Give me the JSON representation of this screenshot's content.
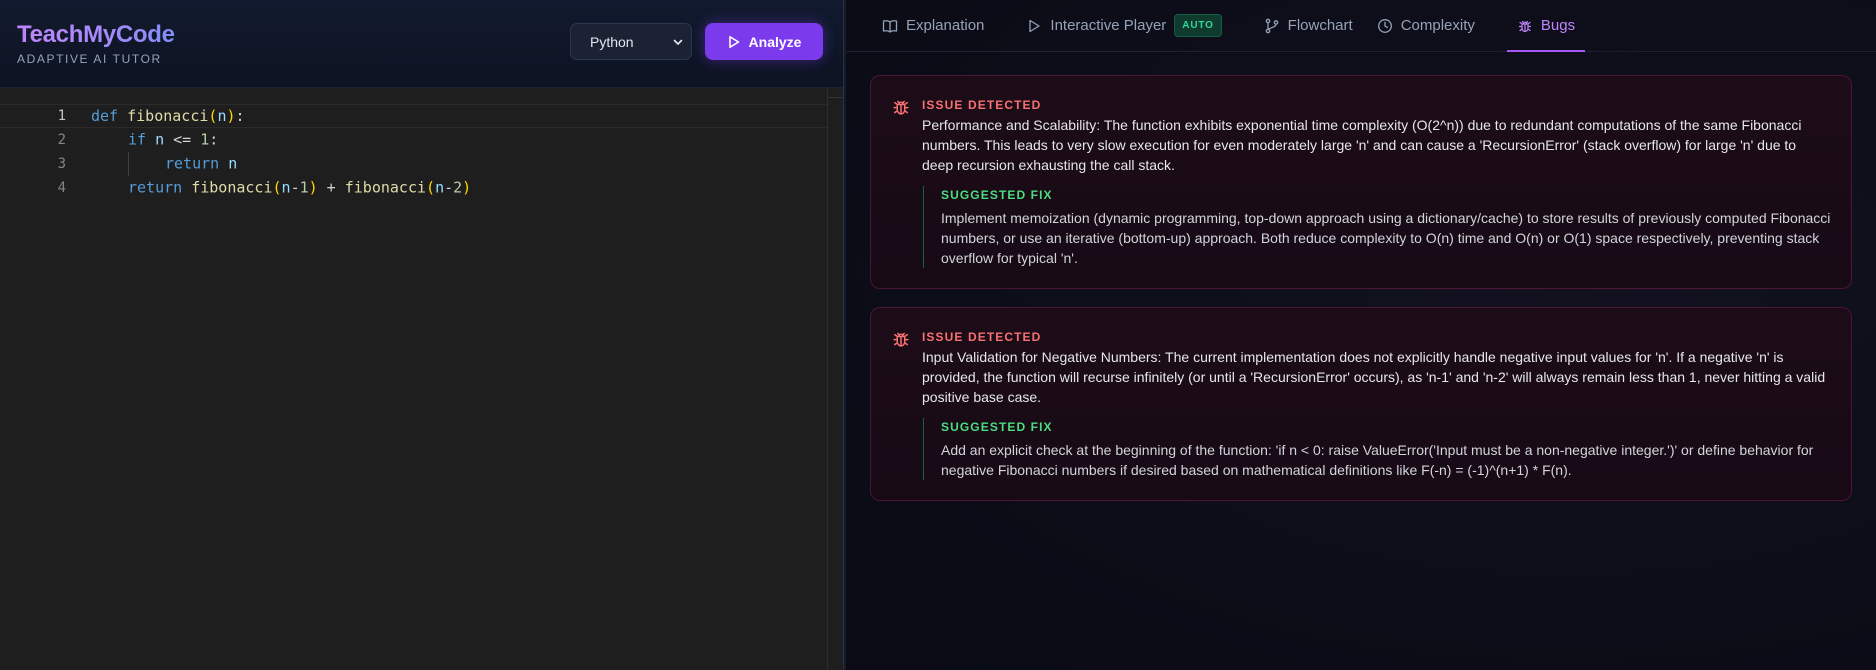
{
  "brand": {
    "title": "TeachMyCode",
    "subtitle": "ADAPTIVE AI TUTOR"
  },
  "controls": {
    "language": "Python",
    "analyze_label": "Analyze"
  },
  "editor": {
    "line_numbers": [
      "1",
      "2",
      "3",
      "4"
    ],
    "lines": [
      "def fibonacci(n):",
      "    if n <= 1:",
      "        return n",
      "    return fibonacci(n-1) + fibonacci(n-2)"
    ]
  },
  "tabs": [
    {
      "label": "Explanation",
      "icon": "book-open-icon"
    },
    {
      "label": "Interactive Player",
      "icon": "play-icon",
      "badge": "AUTO"
    },
    {
      "label": "Flowchart",
      "icon": "git-branch-icon"
    },
    {
      "label": "Complexity",
      "icon": "clock-icon"
    },
    {
      "label": "Bugs",
      "icon": "bug-icon",
      "active": true
    }
  ],
  "issues": [
    {
      "label": "ISSUE DETECTED",
      "text": "Performance and Scalability: The function exhibits exponential time complexity (O(2^n)) due to redundant computations of the same Fibonacci numbers. This leads to very slow execution for even moderately large 'n' and can cause a 'RecursionError' (stack overflow) for large 'n' due to deep recursion exhausting the call stack.",
      "fix_label": "SUGGESTED FIX",
      "fix_text": "Implement memoization (dynamic programming, top-down approach using a dictionary/cache) to store results of previously computed Fibonacci numbers, or use an iterative (bottom-up) approach. Both reduce complexity to O(n) time and O(n) or O(1) space respectively, preventing stack overflow for typical 'n'."
    },
    {
      "label": "ISSUE DETECTED",
      "text": "Input Validation for Negative Numbers: The current implementation does not explicitly handle negative input values for 'n'. If a negative 'n' is provided, the function will recurse infinitely (or until a 'RecursionError' occurs), as 'n-1' and 'n-2' will always remain less than 1, never hitting a valid positive base case.",
      "fix_label": "SUGGESTED FIX",
      "fix_text": "Add an explicit check at the beginning of the function: 'if n < 0: raise ValueError('Input must be a non-negative integer.')' or define behavior for negative Fibonacci numbers if desired based on mathematical definitions like F(-n) = (-1)^(n+1) * F(n)."
    }
  ],
  "colors": {
    "accent": "#a855f7",
    "button": "#7c3aed",
    "issue": "#f87171",
    "fix": "#4ade80",
    "badge": "#34d399"
  }
}
